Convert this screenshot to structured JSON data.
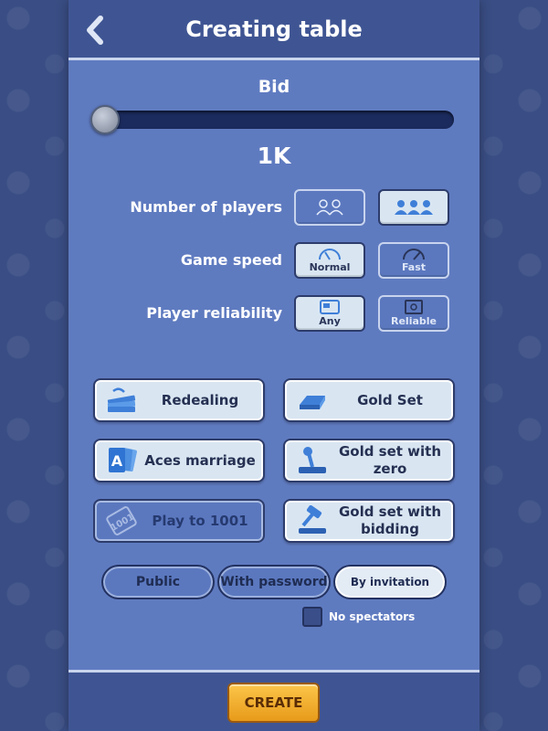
{
  "header": {
    "title": "Creating table",
    "back_icon": "chevron-left-icon"
  },
  "bid": {
    "label": "Bid",
    "value": "1K",
    "slider_position": 0
  },
  "options": {
    "players": {
      "label": "Number of players",
      "choices": [
        "2 players",
        "3 players"
      ],
      "selected": 1
    },
    "speed": {
      "label": "Game speed",
      "choices": [
        "Normal",
        "Fast"
      ],
      "selected": 0
    },
    "reliability": {
      "label": "Player reliability",
      "choices": [
        "Any",
        "Reliable"
      ],
      "selected": 0
    }
  },
  "features": [
    {
      "label": "Redealing",
      "icon": "cards-icon",
      "enabled": true
    },
    {
      "label": "Gold Set",
      "icon": "gold-bar-icon",
      "enabled": true
    },
    {
      "label": "Aces marriage",
      "icon": "ace-card-icon",
      "enabled": true
    },
    {
      "label": "Gold set with zero",
      "icon": "joystick-icon",
      "enabled": true
    },
    {
      "label": "Play to 1001",
      "icon": "1001-card-icon",
      "enabled": false
    },
    {
      "label": "Gold set with bidding",
      "icon": "gavel-icon",
      "enabled": true
    }
  ],
  "access": {
    "options": [
      "Public",
      "With password",
      "By invitation"
    ],
    "selected": 2
  },
  "spectators": {
    "label": "No spectators",
    "checked": false
  },
  "footer": {
    "create_label": "CREATE"
  },
  "colors": {
    "panel": "#5f7bc0",
    "header": "#3f5593",
    "button_active": "#d9e6f2",
    "create": "#f2ad2e"
  }
}
